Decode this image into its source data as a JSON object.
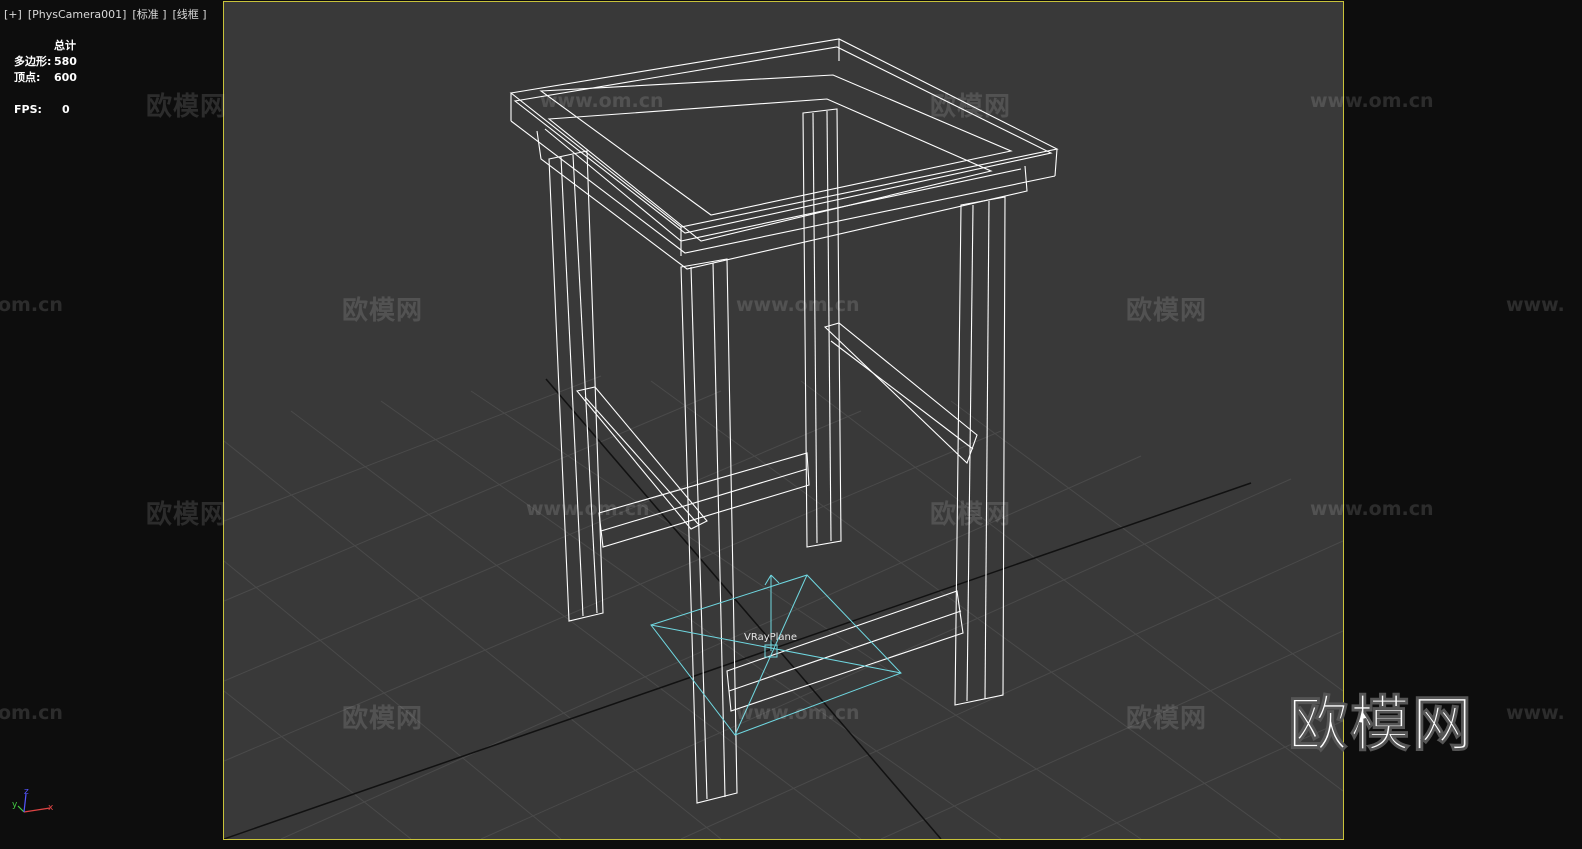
{
  "viewport": {
    "label_plus": "[+]",
    "label_camera": "[PhysCamera001]",
    "label_shading": "[标准 ]",
    "label_mode": "[线框 ]"
  },
  "stats": {
    "header": "总计",
    "polys_label": "多边形:",
    "polys_value": "580",
    "verts_label": "顶点:",
    "verts_value": "600",
    "fps_label": "FPS:",
    "fps_value": "0"
  },
  "scene": {
    "object_label": "VRayPlane",
    "grid_color": "#4a4a4a",
    "grid_axis_color": "#111111",
    "wire_color": "#ffffff",
    "plane_color": "#6fd7e0",
    "viewport_border_color": "#c8c23a"
  },
  "gizmo": {
    "x": "x",
    "y": "y",
    "z": "z"
  },
  "watermarks": {
    "brand_cn": "欧模网",
    "url": "www.om.cn",
    "url_partial": "om.cn",
    "url_start": "www."
  },
  "brand_logo": "欧模网"
}
